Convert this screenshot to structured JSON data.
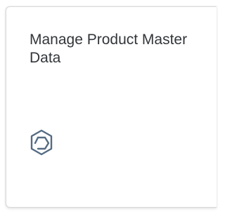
{
  "tile": {
    "title": "Manage Product Master Data",
    "icon": "product-box-icon",
    "icon_color": "#556b82",
    "title_color": "#32363a",
    "border_color": "#d9d9d9"
  }
}
